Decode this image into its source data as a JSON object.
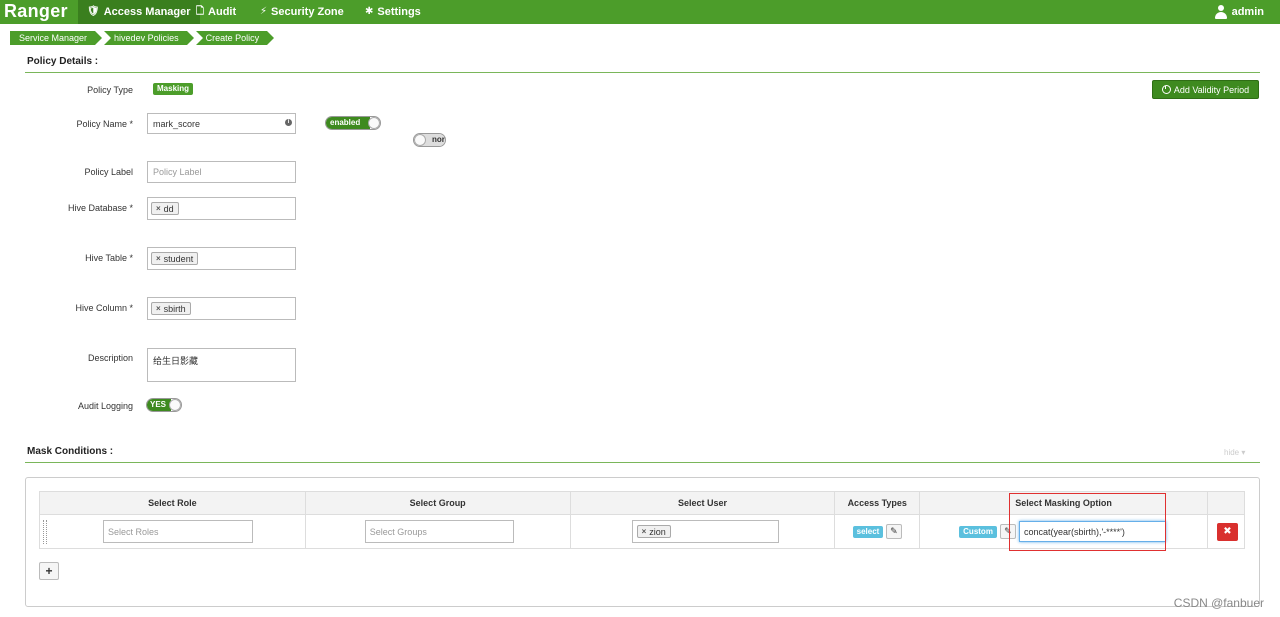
{
  "nav": {
    "brand": "Ranger",
    "items": [
      {
        "label": "Access Manager",
        "icon": "shield-icon"
      },
      {
        "label": "Audit",
        "icon": "file-icon"
      },
      {
        "label": "Security Zone",
        "icon": "zone-icon"
      },
      {
        "label": "Settings",
        "icon": "gear-icon"
      }
    ],
    "user": "admin"
  },
  "breadcrumb": [
    "Service Manager",
    "hivedev Policies",
    "Create Policy"
  ],
  "policy": {
    "section_title": "Policy Details :",
    "type_label": "Policy Type",
    "type_value": "Masking",
    "add_validity_label": "Add Validity Period",
    "name_label": "Policy Name *",
    "name_value": "mark_score",
    "enabled_label": "enabled",
    "normal_label": "nor",
    "label_label": "Policy Label",
    "label_placeholder": "Policy Label",
    "db_label": "Hive Database *",
    "db_value": "dd",
    "table_label": "Hive Table *",
    "table_value": "student",
    "column_label": "Hive Column *",
    "column_value": "sbirth",
    "desc_label": "Description",
    "desc_value": "给生日影藏",
    "audit_label": "Audit Logging",
    "audit_value": "YES"
  },
  "mask": {
    "section_title": "Mask Conditions :",
    "hide_label": "hide ▾",
    "headers": [
      "Select Role",
      "Select Group",
      "Select User",
      "Access Types",
      "Select Masking Option"
    ],
    "row": {
      "role_placeholder": "Select Roles",
      "group_placeholder": "Select Groups",
      "user_value": "zion",
      "access_value": "select",
      "mask_type": "Custom",
      "mask_expr": "concat(year(sbirth),'-****')"
    }
  },
  "watermark": "CSDN @fanbuer",
  "colors": {
    "brand_green": "#4c9d2a",
    "danger": "#d9302e",
    "info": "#5bc0de"
  }
}
